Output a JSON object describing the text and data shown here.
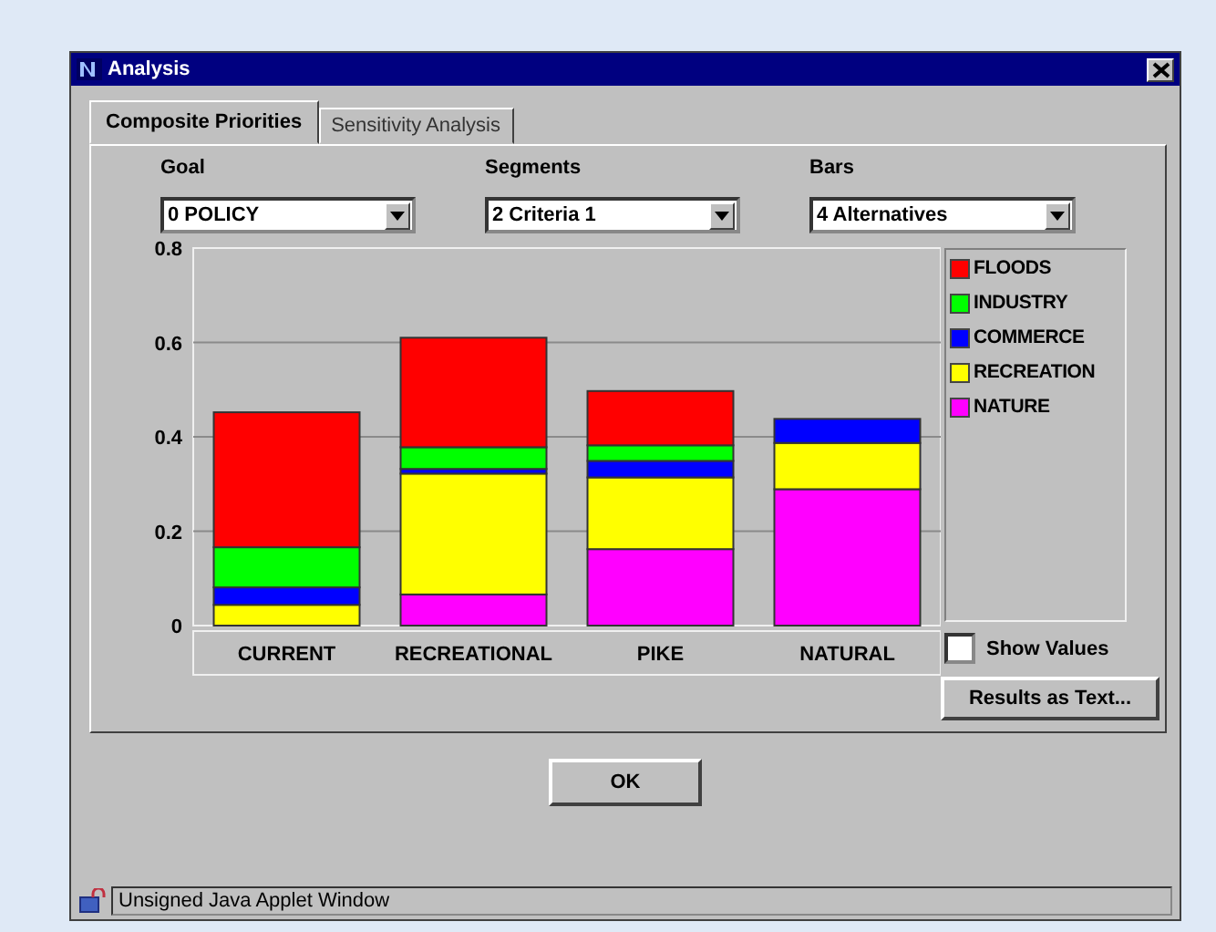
{
  "window": {
    "title": "Analysis"
  },
  "tabs": [
    {
      "label": "Composite Priorities",
      "selected": true
    },
    {
      "label": "Sensitivity Analysis",
      "selected": false
    }
  ],
  "selectors": [
    {
      "label": "Goal",
      "value": "0 POLICY"
    },
    {
      "label": "Segments",
      "value": "2 Criteria 1"
    },
    {
      "label": "Bars",
      "value": "4 Alternatives"
    }
  ],
  "chart_data": {
    "type": "bar",
    "stacked": true,
    "grid": true,
    "categories": [
      "CURRENT",
      "RECREATIONAL",
      "PIKE",
      "NATURAL"
    ],
    "ylim": [
      0,
      0.8
    ],
    "yticks": [
      0,
      0.2,
      0.4,
      0.6,
      0.8
    ],
    "series": [
      {
        "name": "FLOODS",
        "color": "#ff0000",
        "values": [
          0.286,
          0.232,
          0.115,
          0
        ]
      },
      {
        "name": "INDUSTRY",
        "color": "#00ff00",
        "values": [
          0.085,
          0.046,
          0.033,
          0
        ]
      },
      {
        "name": "COMMERCE",
        "color": "#0000ff",
        "values": [
          0.037,
          0.01,
          0.035,
          0.051
        ]
      },
      {
        "name": "RECREATION",
        "color": "#ffff00",
        "values": [
          0.044,
          0.256,
          0.152,
          0.098
        ]
      },
      {
        "name": "NATURE",
        "color": "#ff00ff",
        "values": [
          0,
          0.066,
          0.162,
          0.289
        ]
      }
    ]
  },
  "show_values": {
    "label": "Show Values",
    "checked": false
  },
  "results_button": "Results as Text...",
  "ok_button": "OK",
  "status_bar": "Unsigned Java Applet Window"
}
